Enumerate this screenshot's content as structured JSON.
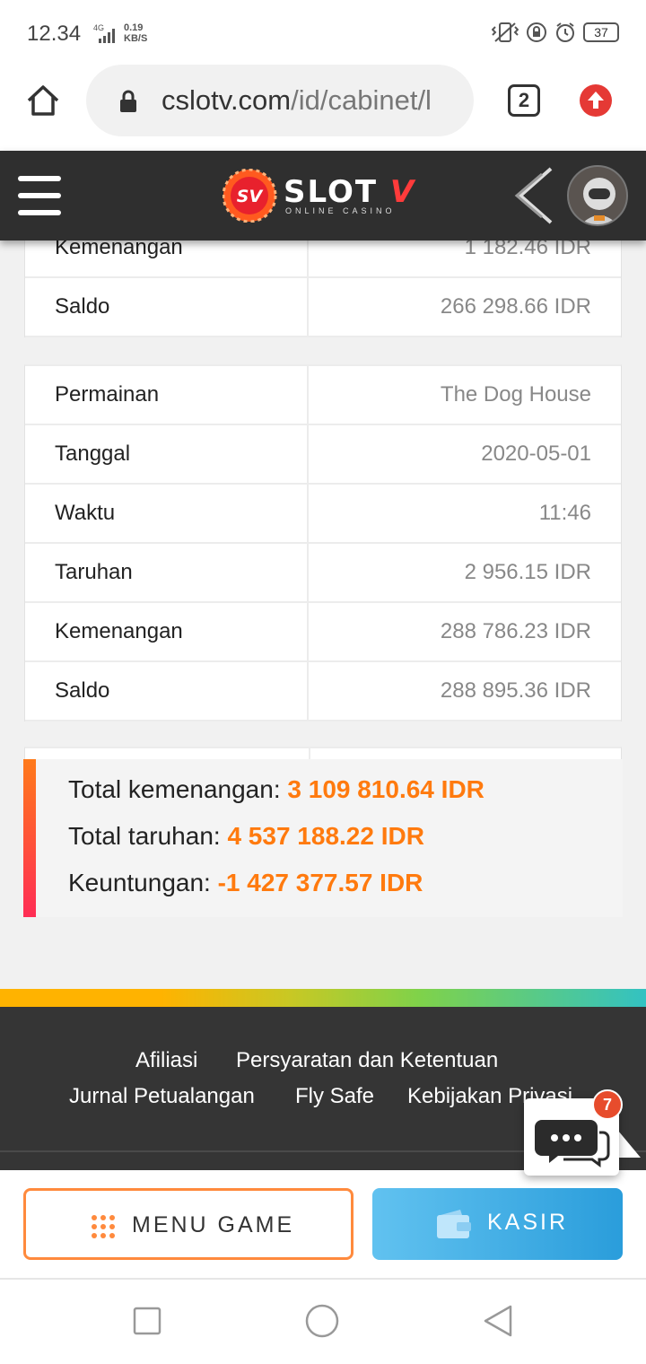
{
  "status_bar": {
    "time": "12.34",
    "network": "4G",
    "speed_value": "0.19",
    "speed_unit": "KB/S",
    "battery": "37"
  },
  "browser": {
    "url_host": "cslotv.com",
    "url_path": "/id/cabinet/l",
    "tab_count": "2"
  },
  "site_header": {
    "logo_badge": "SV",
    "logo_text": "SLOT",
    "logo_text_accent": "V",
    "logo_subtext": "ONLINE CASINO"
  },
  "partial_table": {
    "rows": [
      {
        "label": "Kemenangan",
        "value": "1 182.46 IDR"
      },
      {
        "label": "Saldo",
        "value": "266 298.66 IDR"
      }
    ]
  },
  "game_table": {
    "rows": [
      {
        "label": "Permainan",
        "value": "The Dog House"
      },
      {
        "label": "Tanggal",
        "value": "2020-05-01"
      },
      {
        "label": "Waktu",
        "value": "11:46"
      },
      {
        "label": "Taruhan",
        "value": "2 956.15 IDR"
      },
      {
        "label": "Kemenangan",
        "value": "288 786.23 IDR"
      },
      {
        "label": "Saldo",
        "value": "288 895.36 IDR"
      }
    ]
  },
  "totals": {
    "wins_label": "Total kemenangan:",
    "wins_value": "3 109 810.64 IDR",
    "bets_label": "Total taruhan:",
    "bets_value": "4 537 188.22 IDR",
    "profit_label": "Keuntungan:",
    "profit_value": "-1 427 377.57 IDR",
    "accent_color": "#ff7a0e"
  },
  "footer": {
    "links": [
      "Afiliasi",
      "Persyaratan dan Ketentuan",
      "Jurnal Petualangan",
      "Fly Safe",
      "Kebijakan Privasi"
    ]
  },
  "chat": {
    "badge_count": "7"
  },
  "actions": {
    "menu_game": "MENU GAME",
    "kasir": "KASIR"
  }
}
